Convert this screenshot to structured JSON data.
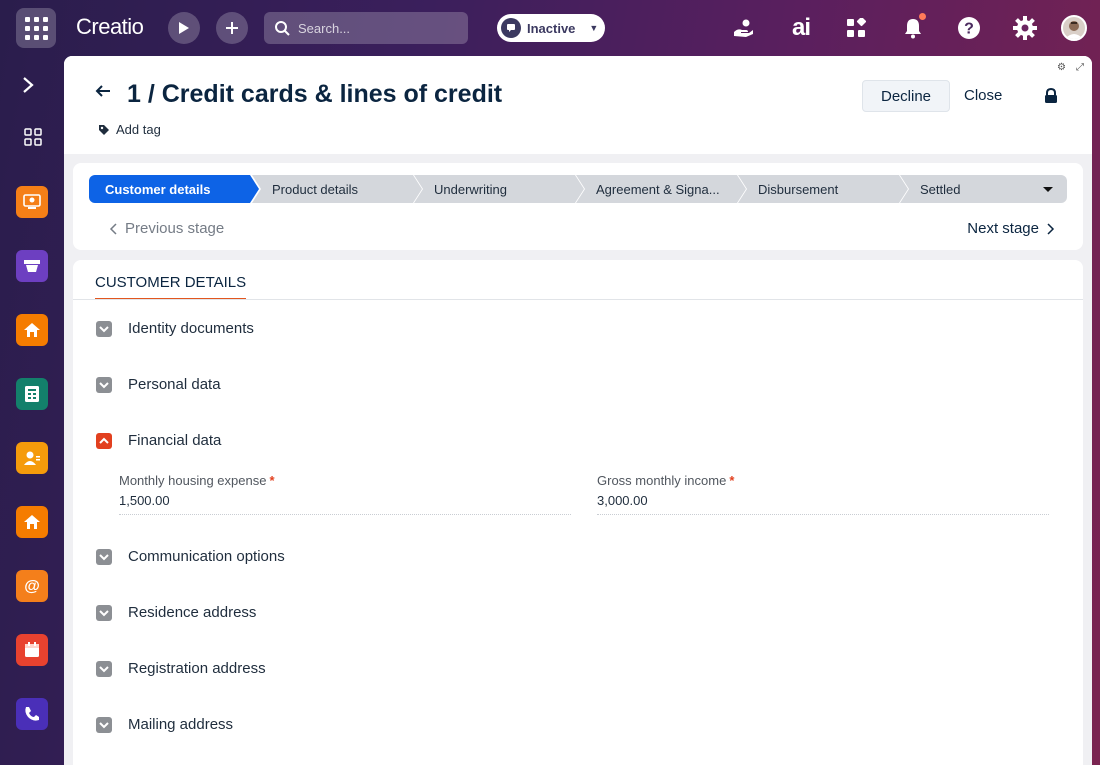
{
  "app": {
    "logo_text": "Creatio",
    "search_placeholder": "Search...",
    "status_label": "Inactive",
    "ai_label": "ai",
    "accent_color": "#0d63e6"
  },
  "rail": {
    "apps": [
      {
        "name": "contacts-app-icon",
        "color": "#f57f17"
      },
      {
        "name": "marketing-app-icon",
        "color": "#6d3fc1"
      },
      {
        "name": "home-app-icon",
        "color": "#f57c00"
      },
      {
        "name": "accounting-app-icon",
        "color": "#13806b"
      },
      {
        "name": "users-app-icon",
        "color": "#f59b0b"
      },
      {
        "name": "home2-app-icon",
        "color": "#f57c00"
      },
      {
        "name": "email-app-icon",
        "color": "#f47f1b"
      },
      {
        "name": "calendar-app-icon",
        "color": "#e8422f"
      },
      {
        "name": "phone-app-icon",
        "color": "#4a2fb8"
      }
    ]
  },
  "header": {
    "title": "1 / Credit cards & lines of credit",
    "add_tag_label": "Add tag",
    "decline_label": "Decline",
    "close_label": "Close"
  },
  "stages": {
    "items": [
      {
        "label": "Customer details",
        "active": true
      },
      {
        "label": "Product details",
        "active": false
      },
      {
        "label": "Underwriting",
        "active": false
      },
      {
        "label": "Agreement & Signa...",
        "active": false
      },
      {
        "label": "Disbursement",
        "active": false
      },
      {
        "label": "Settled",
        "active": false
      }
    ],
    "prev_label": "Previous stage",
    "next_label": "Next stage"
  },
  "details": {
    "tab_label": "CUSTOMER DETAILS",
    "sections": [
      {
        "label": "Identity documents",
        "expanded": false
      },
      {
        "label": "Personal data",
        "expanded": false
      },
      {
        "label": "Financial data",
        "expanded": true
      },
      {
        "label": "Communication options",
        "expanded": false
      },
      {
        "label": "Residence address",
        "expanded": false
      },
      {
        "label": "Registration address",
        "expanded": false
      },
      {
        "label": "Mailing address",
        "expanded": false
      }
    ],
    "financial": {
      "housing_label": "Monthly housing expense",
      "housing_value": "1,500.00",
      "income_label": "Gross monthly income",
      "income_value": "3,000.00",
      "required_mark": "*"
    }
  }
}
